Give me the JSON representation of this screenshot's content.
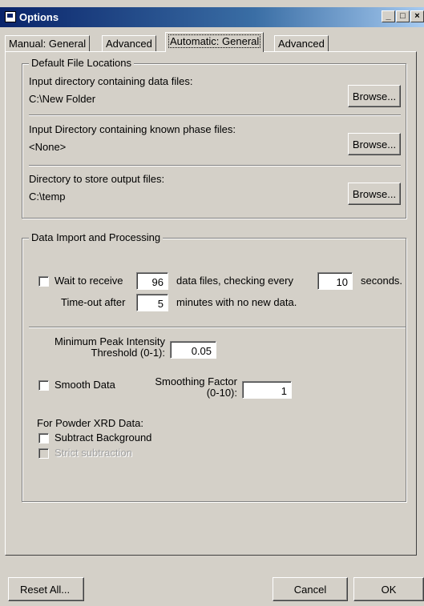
{
  "window": {
    "title": "Options",
    "minimize": "_",
    "maximize": "□",
    "close": "×"
  },
  "tabs": [
    "Manual: General",
    "Advanced",
    "Automatic: General",
    "Advanced"
  ],
  "file_locations": {
    "legend": "Default File Locations",
    "input_dir_label": "Input directory containing data files:",
    "input_dir_value": "C:\\New Folder",
    "phase_dir_label": "Input Directory containing known phase files:",
    "phase_dir_value": "<None>",
    "output_dir_label": "Directory to store output files:",
    "output_dir_value": "C:\\temp",
    "browse_label": "Browse..."
  },
  "processing": {
    "legend": "Data Import and Processing",
    "wait_label": "Wait to receive",
    "wait_count": "96",
    "checking_label": "data files, checking every",
    "check_interval": "10",
    "seconds_label": "seconds.",
    "timeout_label": "Time-out after",
    "timeout_value": "5",
    "timeout_suffix": "minutes with no new data.",
    "min_peak_label_1": "Minimum Peak Intensity",
    "min_peak_label_2": "Threshold (0-1):",
    "min_peak_value": "0.05",
    "smooth_label": "Smooth Data",
    "smoothing_factor_label_1": "Smoothing Factor",
    "smoothing_factor_label_2": "(0-10):",
    "smoothing_factor_value": "1",
    "powder_label": "For Powder XRD Data:",
    "subtract_label": "Subtract Background",
    "strict_label": "Strict subtraction"
  },
  "buttons": {
    "reset": "Reset All...",
    "cancel": "Cancel",
    "ok": "OK"
  }
}
